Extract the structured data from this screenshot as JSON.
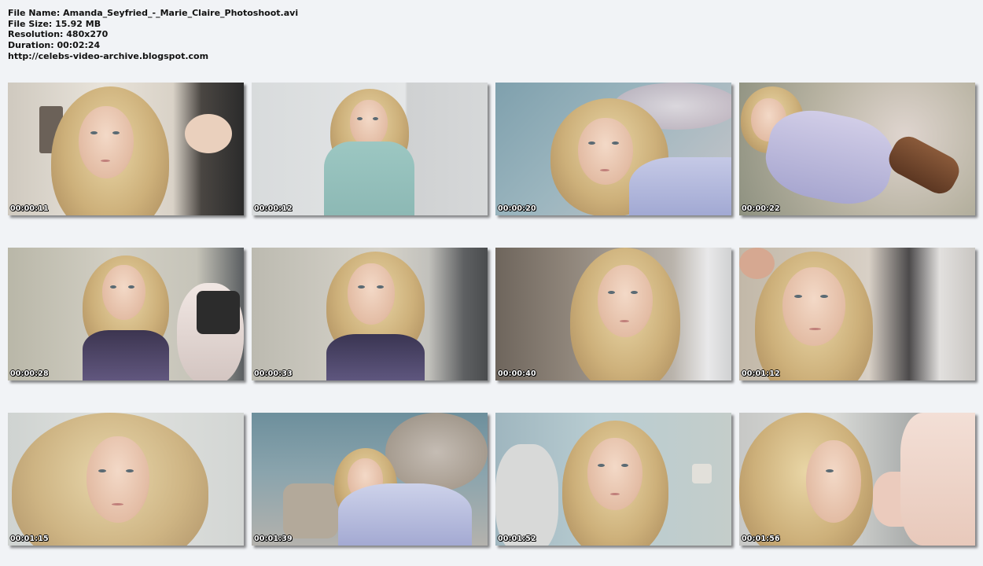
{
  "info": {
    "file_name": "File Name: Amanda_Seyfried_-_Marie_Claire_Photoshoot.avi",
    "file_size": "File Size: 15.92 MB",
    "resolution": "Resolution: 480x270",
    "duration": "Duration: 00:02:24",
    "url": "http://celebs-video-archive.blogspot.com"
  },
  "thumbnails": [
    {
      "time": "00:00:11"
    },
    {
      "time": "00:00:12"
    },
    {
      "time": "00:00:20"
    },
    {
      "time": "00:00:22"
    },
    {
      "time": "00:00:28"
    },
    {
      "time": "00:00:33"
    },
    {
      "time": "00:00:40"
    },
    {
      "time": "00:01:12"
    },
    {
      "time": "00:01:15"
    },
    {
      "time": "00:01:39"
    },
    {
      "time": "00:01:52"
    },
    {
      "time": "00:01:56"
    }
  ]
}
